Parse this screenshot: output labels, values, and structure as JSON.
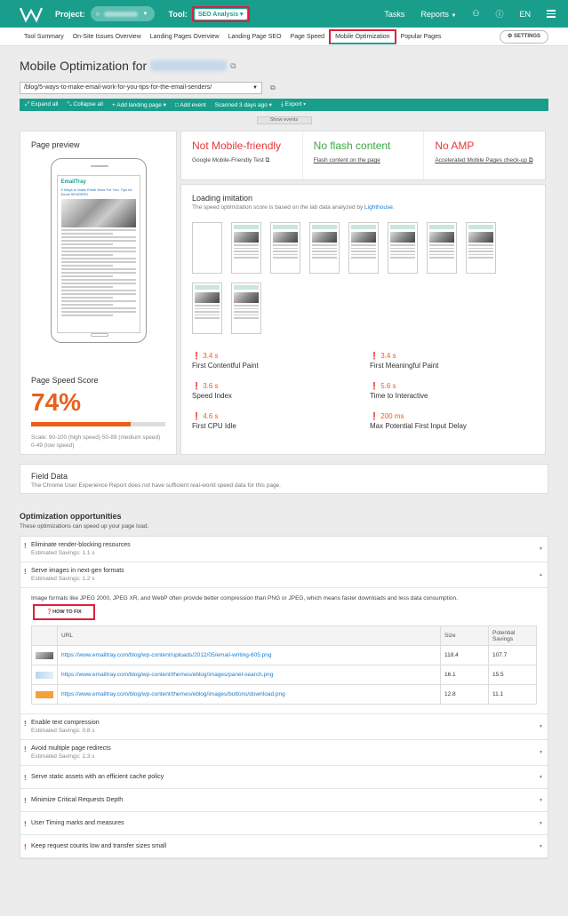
{
  "topbar": {
    "project_label": "Project:",
    "tool_label": "Tool:",
    "tool_value": "SEO Analysis",
    "tasks": "Tasks",
    "reports": "Reports",
    "lang": "EN"
  },
  "subnav": {
    "tabs": [
      "Tool Summary",
      "On-Site Issues Overview",
      "Landing Pages Overview",
      "Landing Page SEO",
      "Page Speed",
      "Mobile Optimization",
      "Popular Pages"
    ],
    "active": "Mobile Optimization",
    "settings": "SETTINGS"
  },
  "page": {
    "title": "Mobile Optimization for",
    "url": "/blog/5-ways-to-make-email-work-for-you-tips-for-the-email-senders/"
  },
  "actions": {
    "expand": "Expand all",
    "collapse": "Collapse all",
    "add_landing": "Add landing page",
    "add_event": "Add event",
    "scanned": "Scanned 3 days ago",
    "export": "Export",
    "show_events": "Show events"
  },
  "preview": {
    "title": "Page preview",
    "pss_title": "Page Speed Score",
    "pss_value": "74%",
    "pss_fraction": 0.74,
    "pss_note": "Scale: 90-100 (high speed) 50-89 (medium speed) 0-49 (low speed)",
    "screen_logo": "EmailTray",
    "screen_headline": "5 Ways to Make Email Work For You: Tips for Email SENDERS"
  },
  "stats": [
    {
      "value": "Not Mobile-friendly",
      "sub": "Google Mobile-Friendly Test",
      "status": "bad"
    },
    {
      "value": "No flash content",
      "sub": "Flash content on the page",
      "status": "ok"
    },
    {
      "value": "No AMP",
      "sub": "Accelerated Mobile Pages check-up",
      "status": "bad"
    }
  ],
  "loading": {
    "title": "Loading imitation",
    "desc": "The speed optimization score is based on the lab data analyzed by",
    "desc_link": "Lighthouse."
  },
  "metrics": [
    {
      "value": "3.4 s",
      "label": "First Contentful Paint"
    },
    {
      "value": "3.4 s",
      "label": "First Meaningful Paint"
    },
    {
      "value": "3.6 s",
      "label": "Speed Index"
    },
    {
      "value": "5.6 s",
      "label": "Time to Interactive"
    },
    {
      "value": "4.6 s",
      "label": "First CPU Idle"
    },
    {
      "value": "200 ms",
      "label": "Max Potential First Input Delay"
    }
  ],
  "field": {
    "title": "Field Data",
    "desc": "The Chrome User Experience Report does not have sufficient real-world speed data for this page."
  },
  "opportunities": {
    "title": "Optimization opportunities",
    "sub": "These optimizations can speed up your page load.",
    "items": [
      {
        "title": "Eliminate render-blocking resources",
        "savings": "Estimated Savings: 1.1 s"
      },
      {
        "title": "Serve images in next-gen formats",
        "savings": "Estimated Savings: 1.2 s"
      }
    ],
    "expanded_text": "Image formats like JPEG 2000, JPEG XR, and WebP often provide better compression than PNG or JPEG, which means faster downloads and less data consumption.",
    "how_to_fix": "HOW TO FIX",
    "table": {
      "headers": [
        "URL",
        "Size",
        "Potential Savings"
      ],
      "rows": [
        {
          "url": "https://www.emailtray.com/blog/wp-content/uploads/2012/05/email-writing-605.png",
          "size": "118.4",
          "savings": "107.7"
        },
        {
          "url": "https://www.emailtray.com/blog/wp-content/themes/eblog/images/panel-search.png",
          "size": "16.1",
          "savings": "15.5"
        },
        {
          "url": "https://www.emailtray.com/blog/wp-content/themes/eblog/images/buttons/download.png",
          "size": "12.8",
          "savings": "11.1"
        }
      ]
    },
    "more": [
      {
        "title": "Enable text compression",
        "savings": "Estimated Savings: 0.8 s"
      },
      {
        "title": "Avoid multiple page redirects",
        "savings": "Estimated Savings: 1.3 s"
      },
      {
        "title": "Serve static assets with an efficient cache policy",
        "savings": ""
      },
      {
        "title": "Minimize Critical Requests Depth",
        "savings": ""
      },
      {
        "title": "User Timing marks and measures",
        "savings": ""
      },
      {
        "title": "Keep request counts low and transfer sizes small",
        "savings": ""
      }
    ]
  },
  "colors": {
    "brand": "#1a9e8c",
    "bad": "#e8373a",
    "ok": "#3aa845",
    "warn": "#e8601c",
    "highlight": "#e01f3d"
  }
}
